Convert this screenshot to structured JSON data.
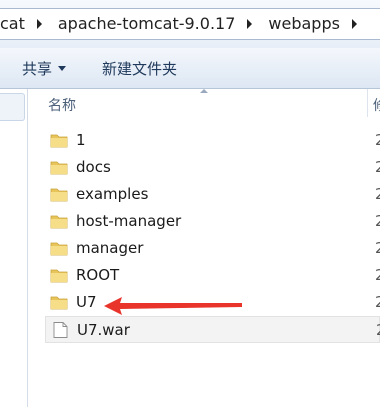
{
  "address_bar": {
    "crumbs": [
      "cat",
      "apache-tomcat-9.0.17",
      "webapps"
    ]
  },
  "toolbar": {
    "share_label": "共享",
    "new_folder_label": "新建文件夹"
  },
  "columns": {
    "name_header": "名称",
    "date_header": "修"
  },
  "files": [
    {
      "name": "1",
      "type": "folder",
      "date_prefix": "2"
    },
    {
      "name": "docs",
      "type": "folder",
      "date_prefix": "2"
    },
    {
      "name": "examples",
      "type": "folder",
      "date_prefix": "2"
    },
    {
      "name": "host-manager",
      "type": "folder",
      "date_prefix": "2"
    },
    {
      "name": "manager",
      "type": "folder",
      "date_prefix": "2"
    },
    {
      "name": "ROOT",
      "type": "folder",
      "date_prefix": "2"
    },
    {
      "name": "U7",
      "type": "folder",
      "date_prefix": "2"
    },
    {
      "name": "U7.war",
      "type": "file",
      "date_prefix": "2"
    }
  ],
  "colors": {
    "annotation_arrow": "#e8342a",
    "folder": "#e8c55b"
  }
}
